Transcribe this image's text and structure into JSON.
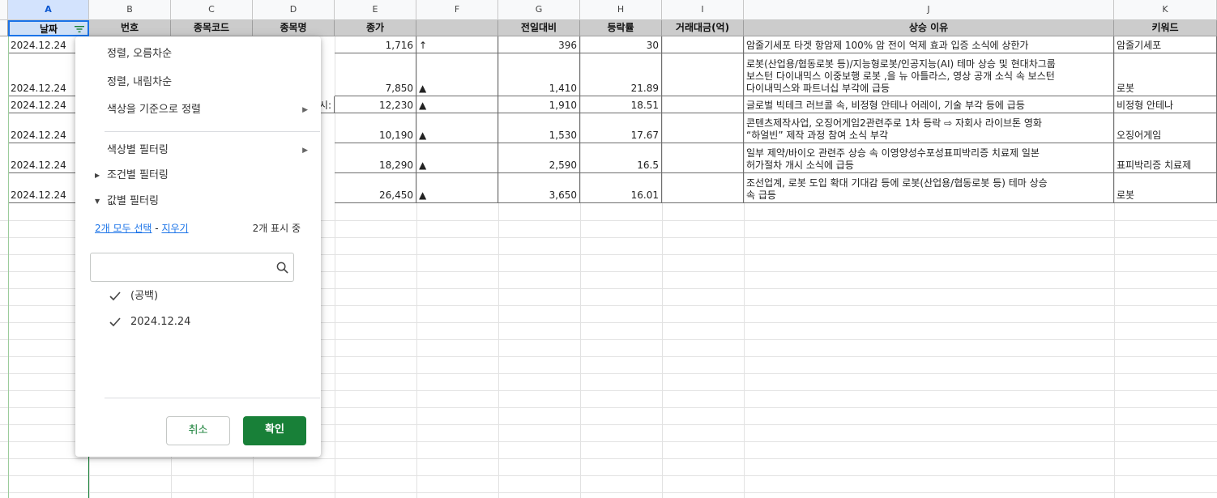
{
  "columns": [
    "A",
    "B",
    "C",
    "D",
    "E",
    "F",
    "G",
    "H",
    "I",
    "J",
    "K"
  ],
  "headers": [
    "날짜",
    "번호",
    "종목코드",
    "종목명",
    "종가",
    "",
    "전일대비",
    "등락률",
    "거래대금(억)",
    "상승 이유",
    "키워드"
  ],
  "rows": [
    {
      "date": "2024.12.24",
      "code": "",
      "name": "",
      "close": "1,716",
      "dir": "↑",
      "change": "396",
      "rate": "30",
      "amount": "",
      "reason": "암줄기세포 타겟 항암제 100% 암 전이 억제 효과 입증 소식에 상한가",
      "keyword": "암줄기세포"
    },
    {
      "date": "2024.12.24",
      "code": "",
      "name": "",
      "close": "7,850",
      "dir": "▲",
      "change": "1,410",
      "rate": "21.89",
      "amount": "",
      "reason": "로봇(산업용/협동로봇 등)/지능형로봇/인공지능(AI) 테마 상승 및 현대차그룹\n보스턴 다이내믹스 이중보행 로봇 ,을 뉴 아틀라스, 영상 공개 소식 속 보스턴\n다이내믹스와 파트너십 부각에 급등",
      "keyword": "로봇"
    },
    {
      "date": "2024.12.24",
      "code": "",
      "name": "시:",
      "close": "12,230",
      "dir": "▲",
      "change": "1,910",
      "rate": "18.51",
      "amount": "",
      "reason": "글로벌 빅테크 러브콜 속, 비정형 안테나 어레이, 기술 부각 등에 급등",
      "keyword": "비정형 안테나"
    },
    {
      "date": "2024.12.24",
      "code": "",
      "name": "",
      "close": "10,190",
      "dir": "▲",
      "change": "1,530",
      "rate": "17.67",
      "amount": "",
      "reason": "콘텐츠제작사업, 오징어게임2관련주로 1차 등락 ⇨ 자회사 라이브톤 영화\n“하얼빈” 제작 과정 참여 소식 부각",
      "keyword": "오징어게임"
    },
    {
      "date": "2024.12.24",
      "code": "",
      "name": "",
      "close": "18,290",
      "dir": "▲",
      "change": "2,590",
      "rate": "16.5",
      "amount": "",
      "reason": "일부 제약/바이오 관련주 상승 속 이영양성수포성표피박리증 치료제 일본\n허가절차 개시 소식에 급등",
      "keyword": "표피박리증 치료제"
    },
    {
      "date": "2024.12.24",
      "code": "",
      "name": "",
      "close": "26,450",
      "dir": "▲",
      "change": "3,650",
      "rate": "16.01",
      "amount": "",
      "reason": "조선업계, 로봇 도입 확대 기대감 등에 로봇(산업용/협동로봇 등) 테마 상승\n속 급등",
      "keyword": "로봇"
    }
  ],
  "menu": {
    "sort_asc": "정렬, 오름차순",
    "sort_desc": "정렬, 내림차순",
    "sort_color": "색상을 기준으로 정렬",
    "filter_color": "색상별 필터링",
    "filter_condition": "조건별 필터링",
    "filter_value": "값별 필터링",
    "select_all": "2개 모두 선택",
    "dash": " - ",
    "clear": "지우기",
    "showing": "2개 표시 중",
    "search_placeholder": "",
    "values": [
      "(공백)",
      "2024.12.24"
    ],
    "cancel": "취소",
    "ok": "확인"
  },
  "colors": {
    "accent": "#188038",
    "link": "#1a73e8",
    "header_bg": "#cccccc"
  }
}
